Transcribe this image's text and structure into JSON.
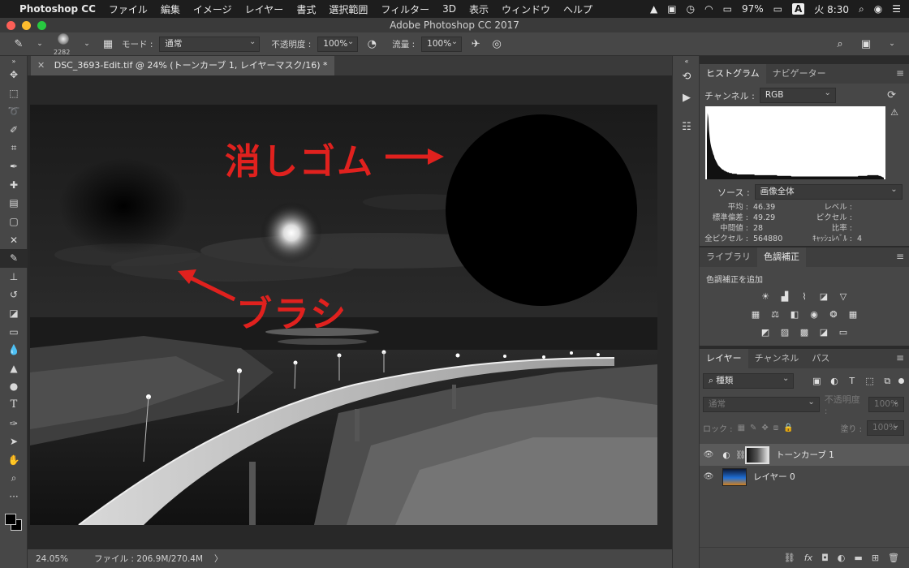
{
  "menubar": {
    "app": "Photoshop CC",
    "items": [
      "ファイル",
      "編集",
      "イメージ",
      "レイヤー",
      "書式",
      "選択範囲",
      "フィルター",
      "3D",
      "表示",
      "ウィンドウ",
      "ヘルプ"
    ],
    "battery": "97%",
    "input_mode": "A",
    "clock": "火 8:30"
  },
  "window": {
    "title": "Adobe Photoshop CC 2017"
  },
  "options": {
    "brush_size": "2282",
    "mode_label": "モード :",
    "mode_value": "通常",
    "opacity_label": "不透明度 :",
    "opacity_value": "100%",
    "flow_label": "流量 :",
    "flow_value": "100%"
  },
  "document": {
    "tab_title": "DSC_3693-Edit.tif @ 24% (トーンカーブ 1, レイヤーマスク/16) *",
    "annotation_eraser": "消しゴム",
    "annotation_brush": "ブラシ"
  },
  "status": {
    "zoom": "24.05%",
    "file_info": "ファイル : 206.9M/270.4M",
    "arrow": "〉"
  },
  "histogram_panel": {
    "tabs": [
      "ヒストグラム",
      "ナビゲーター"
    ],
    "channel_label": "チャンネル :",
    "channel_value": "RGB",
    "source_label": "ソース :",
    "source_value": "画像全体",
    "stats": {
      "mean_label": "平均 :",
      "mean": "46.39",
      "level_label": "レベル :",
      "level": "",
      "std_label": "標準偏差 :",
      "std": "49.29",
      "pixel_label": "ピクセル :",
      "pixel": "",
      "median_label": "中間値 :",
      "median": "28",
      "ratio_label": "比率 :",
      "ratio": "",
      "total_label": "全ピクセル :",
      "total": "564880",
      "cache_label": "ｷｬｯｼｭﾚﾍﾞﾙ :",
      "cache": "4"
    },
    "histogram_values": [
      0.62,
      0.95,
      0.88,
      0.7,
      0.6,
      0.52,
      0.47,
      0.43,
      0.4,
      0.36,
      0.34,
      0.3,
      0.28,
      0.26,
      0.24,
      0.22,
      0.2,
      0.19,
      0.18,
      0.17,
      0.16,
      0.15,
      0.14,
      0.14,
      0.13,
      0.12,
      0.12,
      0.11,
      0.11,
      0.1,
      0.1,
      0.1,
      0.09,
      0.09,
      0.09,
      0.09,
      0.08,
      0.08,
      0.08,
      0.08,
      0.08,
      0.08,
      0.08,
      0.07,
      0.07,
      0.07,
      0.07,
      0.07,
      0.07,
      0.07,
      0.07,
      0.07,
      0.07,
      0.07,
      0.07,
      0.07,
      0.07,
      0.07,
      0.07,
      0.07,
      0.07,
      0.07,
      0.07,
      0.07,
      0.07,
      0.07,
      0.07,
      0.07,
      0.06,
      0.06,
      0.06,
      0.06,
      0.06,
      0.06,
      0.06,
      0.06,
      0.06,
      0.06,
      0.06,
      0.06,
      0.06,
      0.06,
      0.06,
      0.06,
      0.06,
      0.06,
      0.06,
      0.06,
      0.06,
      0.06,
      0.06,
      0.06,
      0.06,
      0.06,
      0.06,
      0.06,
      0.06,
      0.06,
      0.06,
      0.06,
      0.05,
      0.05,
      0.05,
      0.05,
      0.05,
      0.05,
      0.05,
      0.05,
      0.05,
      0.05,
      0.05,
      0.05,
      0.05,
      0.05,
      0.05,
      0.05,
      0.05,
      0.05,
      0.05,
      0.05,
      0.04,
      0.04,
      0.04,
      0.04,
      0.04,
      0.04,
      0.04,
      0.04,
      0.04,
      0.04,
      0.04,
      0.04,
      0.04,
      0.04,
      0.04,
      0.04,
      0.04,
      0.04,
      0.04,
      0.04,
      0.04,
      0.04,
      0.04,
      0.04,
      0.04,
      0.04,
      0.04,
      0.04,
      0.04,
      0.04,
      0.04,
      0.04,
      0.04,
      0.04,
      0.04,
      0.04,
      0.04,
      0.04,
      0.04,
      0.04,
      0.04,
      0.04,
      0.04,
      0.04,
      0.04,
      0.04,
      0.04,
      0.04,
      0.04,
      0.04,
      0.04,
      0.04,
      0.04,
      0.04,
      0.04,
      0.04,
      0.04,
      0.04,
      0.04,
      0.04,
      0.04,
      0.04,
      0.04,
      0.04,
      0.04,
      0.04,
      0.04,
      0.04,
      0.04,
      0.04,
      0.04,
      0.04,
      0.04,
      0.04,
      0.04,
      0.04,
      0.04,
      0.04,
      0.04,
      0.04,
      0.04,
      0.04,
      0.04,
      0.04,
      0.04,
      0.04,
      0.04,
      0.04,
      0.04,
      0.04,
      0.04,
      0.04,
      0.04,
      0.04,
      0.04,
      0.05,
      0.05,
      0.05,
      0.05,
      0.05,
      0.05,
      0.05,
      0.05,
      0.05,
      0.05,
      0.05,
      0.05,
      0.05,
      0.06,
      0.06,
      0.06,
      0.06,
      0.06,
      0.06,
      0.06,
      0.06,
      0.06,
      0.06,
      0.06,
      0.06,
      0.06,
      0.06,
      0.06,
      0.06,
      0.05,
      0.05,
      0.05,
      0.04,
      0.04,
      0.03,
      0.03,
      0.02
    ]
  },
  "adjust_panel": {
    "tabs": [
      "ライブラリ",
      "色調補正"
    ],
    "add_label": "色調補正を追加",
    "rows": [
      [
        "sun-icon",
        "levels-icon",
        "curves-icon",
        "exposure-icon",
        "triangle-icon"
      ],
      [
        "hue-icon",
        "balance-icon",
        "bw-icon",
        "camera-icon",
        "mixer-icon",
        "lookup-icon"
      ],
      [
        "invert-icon",
        "posterize-icon",
        "threshold-icon",
        "selective-icon",
        "gradient-map-icon"
      ]
    ]
  },
  "layers_panel": {
    "tabs": [
      "レイヤー",
      "チャンネル",
      "パス"
    ],
    "filter_value": "種類",
    "blend_value": "通常",
    "opacity_label": "不透明度 :",
    "opacity_value": "100%",
    "lock_label": "ロック :",
    "fill_label": "塗り :",
    "fill_value": "100%",
    "layers": [
      {
        "name": "トーンカーブ 1",
        "selected": true
      },
      {
        "name": "レイヤー 0",
        "selected": false
      }
    ]
  },
  "colors": {
    "annotation_red": "#e0211e",
    "accent_blue": "#1f6fd6"
  }
}
